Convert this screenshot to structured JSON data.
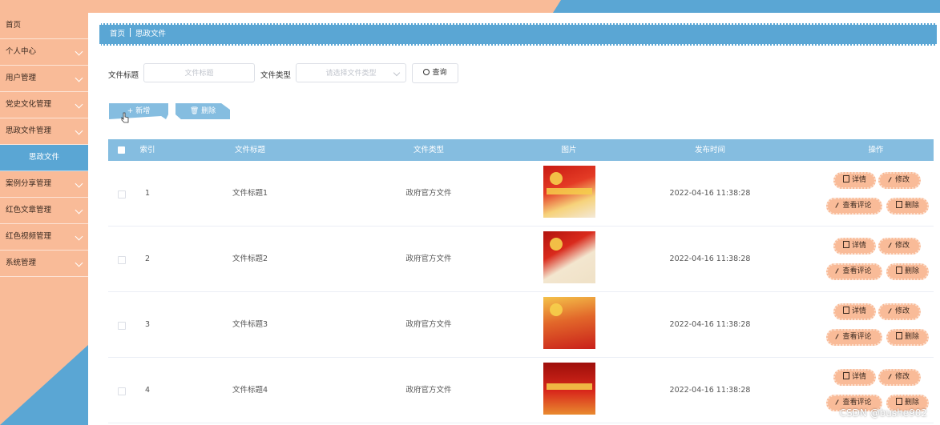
{
  "sidebar": {
    "items": [
      {
        "label": "首页",
        "chevron": false
      },
      {
        "label": "个人中心",
        "chevron": true
      },
      {
        "label": "用户管理",
        "chevron": true
      },
      {
        "label": "党史文化管理",
        "chevron": true
      },
      {
        "label": "思政文件管理",
        "chevron": true
      },
      {
        "label": "思政文件",
        "chevron": false,
        "sub": true
      },
      {
        "label": "案例分享管理",
        "chevron": true
      },
      {
        "label": "红色文章管理",
        "chevron": true
      },
      {
        "label": "红色视频管理",
        "chevron": true
      },
      {
        "label": "系统管理",
        "chevron": true
      }
    ]
  },
  "breadcrumb": {
    "home": "首页",
    "current": "思政文件"
  },
  "search": {
    "title_label": "文件标题",
    "title_placeholder": "文件标题",
    "type_label": "文件类型",
    "type_placeholder": "请选择文件类型",
    "query_label": "查询"
  },
  "actions": {
    "add_label": "新增",
    "delete_label": "删除"
  },
  "table": {
    "headers": {
      "index": "索引",
      "title": "文件标题",
      "type": "文件类型",
      "image": "图片",
      "time": "发布时间",
      "ops": "操作"
    },
    "rows": [
      {
        "index": "1",
        "title": "文件标题1",
        "type": "政府官方文件",
        "time": "2022-04-16 11:38:28"
      },
      {
        "index": "2",
        "title": "文件标题2",
        "type": "政府官方文件",
        "time": "2022-04-16 11:38:28"
      },
      {
        "index": "3",
        "title": "文件标题3",
        "type": "政府官方文件",
        "time": "2022-04-16 11:38:28"
      },
      {
        "index": "4",
        "title": "文件标题4",
        "type": "政府官方文件",
        "time": "2022-04-16 11:38:28"
      }
    ],
    "ops": {
      "detail": "详情",
      "edit": "修改",
      "comments": "查看评论",
      "delete": "删除"
    }
  },
  "watermark": "CSDN @bushe902",
  "colors": {
    "peach": "#f9bb98",
    "blue": "#5aa6d4",
    "light_blue": "#85bde0"
  }
}
